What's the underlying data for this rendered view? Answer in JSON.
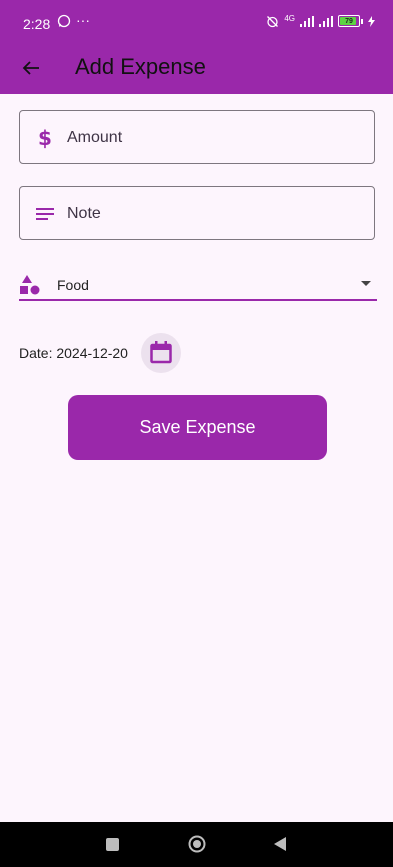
{
  "status_bar": {
    "time": "2:28",
    "more": "···",
    "network": "4G",
    "battery": "79"
  },
  "app_bar": {
    "title": "Add Expense"
  },
  "form": {
    "amount_placeholder": "Amount",
    "note_placeholder": "Note",
    "category_value": "Food",
    "date_text": "Date: 2024-12-20",
    "save_label": "Save Expense"
  },
  "colors": {
    "primary": "#9a28aa",
    "background": "#fdf5fd"
  },
  "icons": {
    "back": "arrow-left-icon",
    "amount": "dollar-icon",
    "note": "notes-icon",
    "category": "category-shapes-icon",
    "calendar": "calendar-icon"
  }
}
